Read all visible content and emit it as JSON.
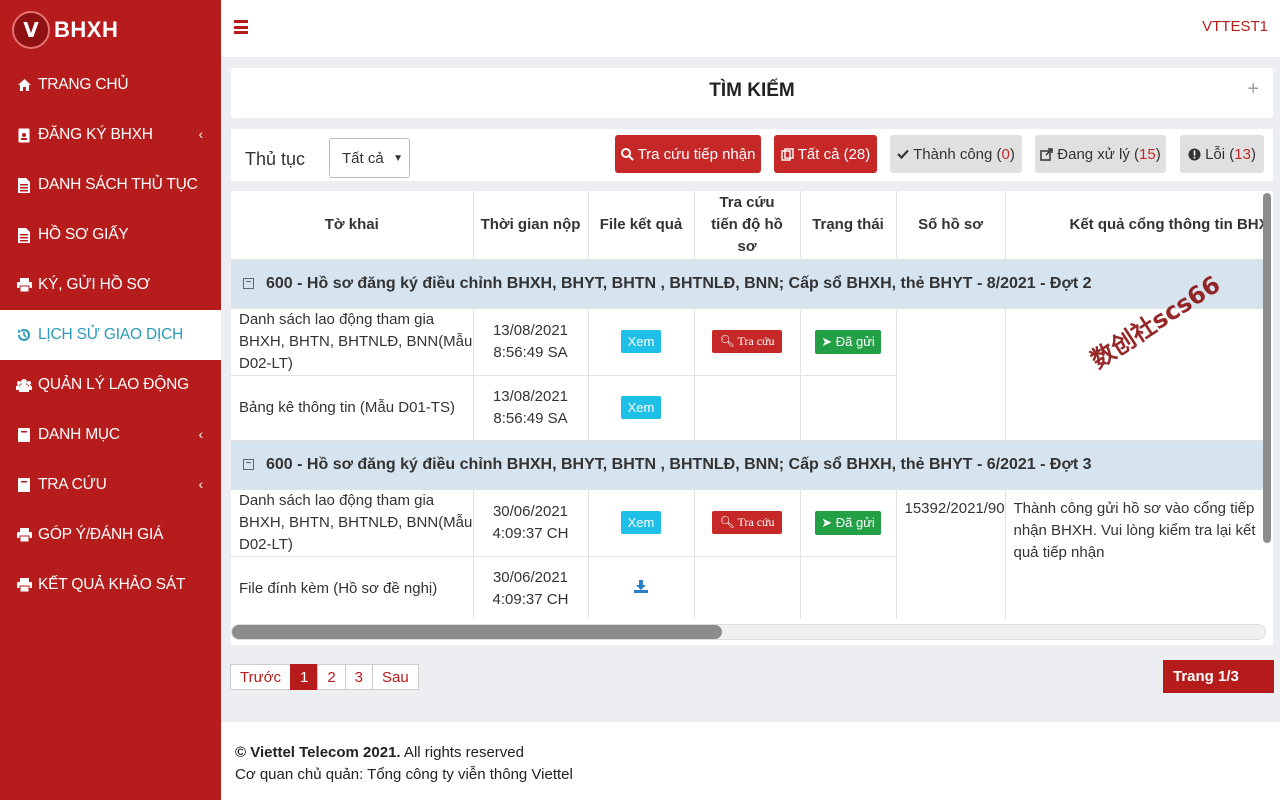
{
  "app": {
    "logo_letter": "V",
    "logo_text": "BHXH"
  },
  "sidebar": {
    "items": [
      {
        "label": "TRANG CHỦ",
        "icon": "home-icon",
        "chevron": false
      },
      {
        "label": "ĐĂNG KÝ BHXH",
        "icon": "id-card-icon",
        "chevron": true
      },
      {
        "label": "DANH SÁCH THỦ TỤC",
        "icon": "file-icon",
        "chevron": false
      },
      {
        "label": "HỒ SƠ GIẤY",
        "icon": "file-icon",
        "chevron": false
      },
      {
        "label": "KÝ, GỬI HỒ SƠ",
        "icon": "print-icon",
        "chevron": false
      },
      {
        "label": "LỊCH SỬ GIAO DỊCH",
        "icon": "history-icon",
        "chevron": false,
        "active": true
      },
      {
        "label": "QUẢN LÝ LAO ĐỘNG",
        "icon": "users-icon",
        "chevron": false
      },
      {
        "label": "DANH MỤC",
        "icon": "book-icon",
        "chevron": true
      },
      {
        "label": "TRA CỨU",
        "icon": "book-icon",
        "chevron": true
      },
      {
        "label": "GÓP Ý/ĐÁNH GIÁ",
        "icon": "print-icon",
        "chevron": false
      },
      {
        "label": "KẾT QUẢ KHẢO SÁT",
        "icon": "print-icon",
        "chevron": false
      }
    ]
  },
  "topbar": {
    "user": "VTTEST1"
  },
  "search": {
    "title": "TÌM KIẾM",
    "expand": "+"
  },
  "filter": {
    "label": "Thủ tục",
    "select_value": "Tất cả",
    "buttons": {
      "lookup": "Tra cứu tiếp nhận",
      "all": {
        "label": "Tất cả",
        "count": "28"
      },
      "success": {
        "label": "Thành công",
        "count": "0"
      },
      "processing": {
        "label": "Đang xử lý",
        "count": "15"
      },
      "error": {
        "label": "Lỗi",
        "count": "13"
      }
    }
  },
  "table": {
    "headers": {
      "form": "Tờ khai",
      "time": "Thời gian nộp",
      "file": "File kết quả",
      "progress": "Tra cứu tiến độ hồ sơ",
      "status": "Trạng thái",
      "number": "Số hồ sơ",
      "portal": "Kết quả cổng thông tin BHXH VN"
    },
    "groups": [
      {
        "title": "600 - Hồ sơ đăng ký điều chỉnh BHXH, BHYT, BHTN , BHTNLĐ, BNN; Cấp sổ BHXH, thẻ BHYT - 8/2021 - Đợt 2",
        "rows": [
          {
            "form": "Danh sách lao động tham gia BHXH, BHTN, BHTNLĐ, BNN(Mẫu D02-LT)",
            "date": "13/08/2021",
            "time": "8:56:49 SA",
            "file": "Xem",
            "lookup": "Tra cứu",
            "status": "Đã gửi"
          },
          {
            "form": "Bảng kê thông tin (Mẫu D01-TS)",
            "date": "13/08/2021",
            "time": "8:56:49 SA",
            "file": "Xem"
          }
        ]
      },
      {
        "title": "600 - Hồ sơ đăng ký điều chỉnh BHXH, BHYT, BHTN , BHTNLĐ, BNN; Cấp sổ BHXH, thẻ BHYT - 6/2021 - Đợt 3",
        "rows": [
          {
            "form": "Danh sách lao động tham gia BHXH, BHTN, BHTNLĐ, BNN(Mẫu D02-LT)",
            "date": "30/06/2021",
            "time": "4:09:37 CH",
            "file": "Xem",
            "lookup": "Tra cứu",
            "status": "Đã gửi",
            "number": "15392/2021/90",
            "portal": "Thành công gửi hồ sơ vào cổng tiếp nhận BHXH. Vui lòng kiểm tra lại kết quả tiếp nhận"
          },
          {
            "form": "File đính kèm (Hồ sơ đề nghị)",
            "date": "30/06/2021",
            "time": "4:09:37 CH"
          }
        ]
      }
    ]
  },
  "pagination": {
    "prev": "Trước",
    "pages": [
      "1",
      "2",
      "3"
    ],
    "next": "Sau",
    "info": "Trang 1/3"
  },
  "footer": {
    "copyright_bold": "© Viettel Telecom 2021.",
    "copyright_rest": " All rights reserved",
    "owner": "Cơ quan chủ quản: Tổng công ty viễn thông Viettel"
  },
  "watermark": "数创社scs66"
}
